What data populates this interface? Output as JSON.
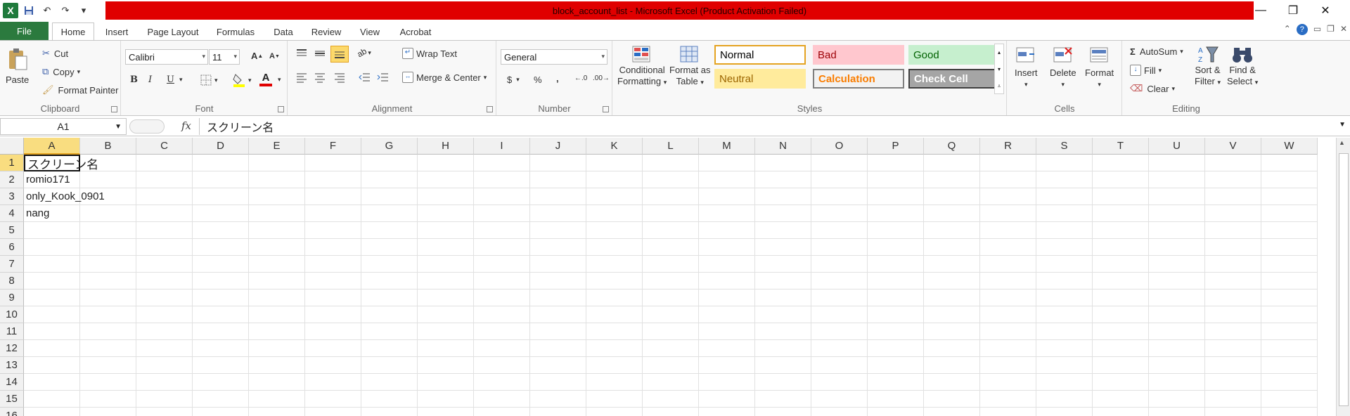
{
  "window": {
    "title": "block_account_list - Microsoft Excel (Product Activation Failed)",
    "title_bar_color": "#e00000"
  },
  "quick_access": {
    "icons": [
      "excel-logo-icon",
      "save-icon",
      "undo-icon",
      "redo-icon",
      "customize-qat-icon"
    ]
  },
  "tabs": {
    "file": "File",
    "items": [
      "Home",
      "Insert",
      "Page Layout",
      "Formulas",
      "Data",
      "Review",
      "View",
      "Acrobat"
    ],
    "active": "Home"
  },
  "ribbon": {
    "clipboard": {
      "label": "Clipboard",
      "paste": "Paste",
      "cut": "Cut",
      "copy": "Copy",
      "format_painter": "Format Painter"
    },
    "font": {
      "label": "Font",
      "font_name": "Calibri",
      "font_size": "11",
      "bold": "B",
      "italic": "I",
      "underline": "U",
      "font_color_glyph": "A"
    },
    "alignment": {
      "label": "Alignment",
      "wrap_text": "Wrap Text",
      "merge_center": "Merge & Center"
    },
    "number": {
      "label": "Number",
      "format": "General",
      "currency": "$",
      "percent": "%",
      "comma": ","
    },
    "styles": {
      "label": "Styles",
      "conditional_formatting_1": "Conditional",
      "conditional_formatting_2": "Formatting",
      "format_as_table_1": "Format as",
      "format_as_table_2": "Table",
      "cells": [
        {
          "name": "Normal",
          "bg": "#ffffff",
          "fg": "#000000",
          "border": "#e4a321"
        },
        {
          "name": "Bad",
          "bg": "#ffc7ce",
          "fg": "#9c0006",
          "border": "#ffc7ce"
        },
        {
          "name": "Good",
          "bg": "#c6efce",
          "fg": "#006100",
          "border": "#c6efce"
        },
        {
          "name": "Neutral",
          "bg": "#ffeb9c",
          "fg": "#9c6500",
          "border": "#ffeb9c"
        },
        {
          "name": "Calculation",
          "bg": "#f2f2f2",
          "fg": "#fa7d00",
          "border": "#7f7f7f"
        },
        {
          "name": "Check Cell",
          "bg": "#a5a5a5",
          "fg": "#ffffff",
          "border": "#3f3f3f"
        }
      ]
    },
    "cells": {
      "label": "Cells",
      "insert": "Insert",
      "delete": "Delete",
      "format": "Format"
    },
    "editing": {
      "label": "Editing",
      "autosum": "AutoSum",
      "fill": "Fill",
      "clear": "Clear",
      "sort_filter_1": "Sort &",
      "sort_filter_2": "Filter",
      "find_select_1": "Find &",
      "find_select_2": "Select"
    }
  },
  "formula_bar": {
    "name_box": "A1",
    "fx": "fx",
    "value": "スクリーン名"
  },
  "sheet": {
    "columns": [
      "A",
      "B",
      "C",
      "D",
      "E",
      "F",
      "G",
      "H",
      "I",
      "J",
      "K",
      "L",
      "M",
      "N",
      "O",
      "P",
      "Q",
      "R",
      "S",
      "T",
      "U",
      "V",
      "W"
    ],
    "rows": [
      "1",
      "2",
      "3",
      "4",
      "5",
      "6",
      "7",
      "8",
      "9",
      "10",
      "11",
      "12",
      "13",
      "14",
      "15",
      "16"
    ],
    "selected_column": "A",
    "selected_row": "1",
    "cells": {
      "A1": "スクリーン名",
      "A2": "romio171",
      "A3": "only_Kook_0901",
      "A4": "nang"
    }
  }
}
